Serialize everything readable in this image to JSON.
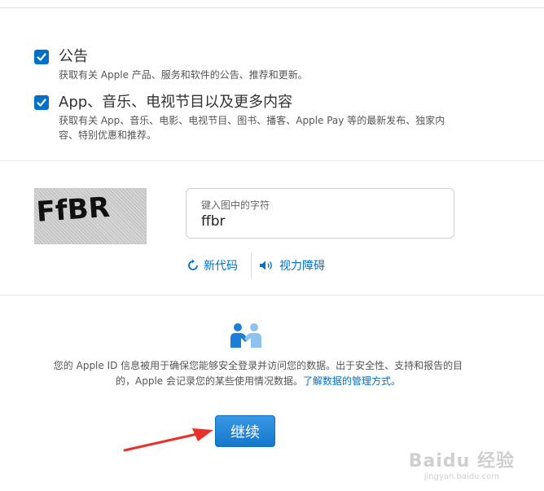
{
  "options": [
    {
      "title": "公告",
      "description": "获取有关 Apple 产品、服务和软件的公告、推荐和更新。",
      "checked": true
    },
    {
      "title": "App、音乐、电视节目以及更多内容",
      "description": "获取有关 App、音乐、电影、电视节目、图书、播客、Apple Pay 等的最新发布、独家内容、特别优惠和推荐。",
      "checked": true
    }
  ],
  "captcha": {
    "image_text": "FfBR",
    "field_label": "键入图中的字符",
    "field_value": "ffbr",
    "new_code_label": "新代码",
    "vision_impaired_label": "视力障碍"
  },
  "privacy": {
    "text": "您的 Apple ID 信息被用于确保您能够安全登录并访问您的数据。出于安全性、支持和报告的目的，Apple 会记录您的某些使用情况数据。",
    "link_text": "了解数据的管理方式。"
  },
  "continue_button": {
    "label": "继续"
  },
  "watermark": {
    "main": "Baidu 经验",
    "sub": "jingyan.baidu.com"
  },
  "colors": {
    "accent": "#0070c9",
    "button": "#1a82d8",
    "arrow": "#e8312a"
  }
}
